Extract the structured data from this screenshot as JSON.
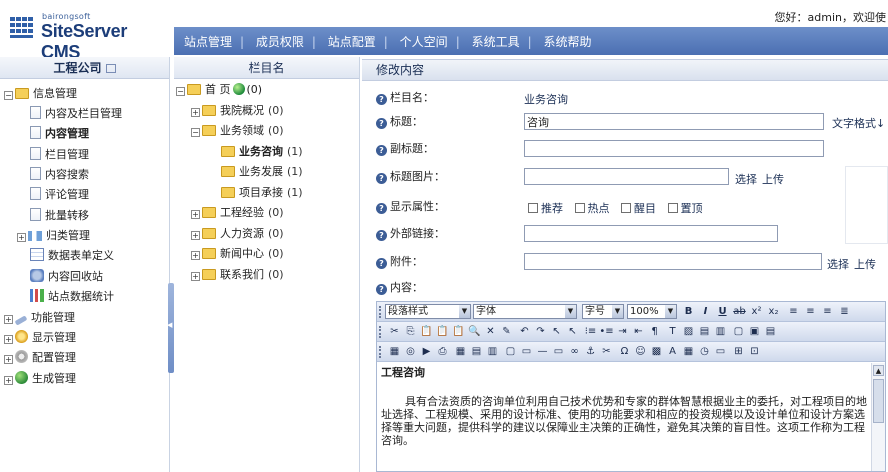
{
  "header": {
    "logo_small": "bairongsoft",
    "logo_big": "SiteServer CMS",
    "welcome": "您好：admin，欢迎使",
    "nav": [
      "站点管理",
      "成员权限",
      "站点配置",
      "个人空间",
      "系统工具",
      "系统帮助"
    ]
  },
  "sidebar": {
    "title": "工程公司",
    "items": [
      {
        "label": "信息管理",
        "icon": "content-folder-icon"
      },
      {
        "label": "内容及栏目管理",
        "icon": "doc-icon"
      },
      {
        "label": "内容管理",
        "icon": "doc-icon"
      },
      {
        "label": "栏目管理",
        "icon": "doc-icon"
      },
      {
        "label": "内容搜索",
        "icon": "doc-icon"
      },
      {
        "label": "评论管理",
        "icon": "doc-icon"
      },
      {
        "label": "批量转移",
        "icon": "doc-icon"
      },
      {
        "label": "归类管理",
        "icon": "tree-icon"
      },
      {
        "label": "数据表单定义",
        "icon": "table-icon"
      },
      {
        "label": "内容回收站",
        "icon": "recycle-icon"
      },
      {
        "label": "站点数据统计",
        "icon": "chart-icon"
      },
      {
        "label": "功能管理",
        "icon": "tool-icon"
      },
      {
        "label": "显示管理",
        "icon": "display-icon"
      },
      {
        "label": "配置管理",
        "icon": "gear-icon"
      },
      {
        "label": "生成管理",
        "icon": "globe-icon"
      }
    ]
  },
  "column_tree": {
    "title": "栏目名",
    "items": [
      {
        "label": "首 页",
        "count": "(0)"
      },
      {
        "label": "我院概况",
        "count": "(0)"
      },
      {
        "label": "业务领域",
        "count": "(0)"
      },
      {
        "label": "业务咨询",
        "count": "(1)"
      },
      {
        "label": "业务发展",
        "count": "(1)"
      },
      {
        "label": "项目承接",
        "count": "(1)"
      },
      {
        "label": "工程经验",
        "count": "(0)"
      },
      {
        "label": "人力资源",
        "count": "(0)"
      },
      {
        "label": "新闻中心",
        "count": "(0)"
      },
      {
        "label": "联系我们",
        "count": "(0)"
      }
    ]
  },
  "form": {
    "title": "修改内容",
    "column_label": "栏目名：",
    "column_value": "业务咨询",
    "title_label": "标题：",
    "title_value": "咨询",
    "text_format": "文字格式↓",
    "subtitle_label": "副标题：",
    "subtitle_value": "",
    "image_label": "标题图片：",
    "image_value": "",
    "select_label": "选择",
    "upload_label": "上传",
    "attr_label": "显示属性：",
    "attrs": [
      "推荐",
      "热点",
      "醒目",
      "置顶"
    ],
    "link_label": "外部链接：",
    "link_value": "",
    "attach_label": "附件：",
    "attach_value": "",
    "content_label": "内容："
  },
  "editor": {
    "style_select": "段落样式",
    "font_select": "字体",
    "size_select": "字号",
    "zoom_select": "100%",
    "heading": "工程咨询",
    "body": "具有合法资质的咨询单位利用自己技术优势和专家的群体智慧根据业主的委托，对工程项目的地址选择、工程规模、采用的设计标准、使用的功能要求和相应的投资规模以及设计单位和设计方案选择等重大问题，提供科学的建议以保障业主决策的正确性，避免其决策的盲目性。这项工作称为工程咨询。"
  }
}
